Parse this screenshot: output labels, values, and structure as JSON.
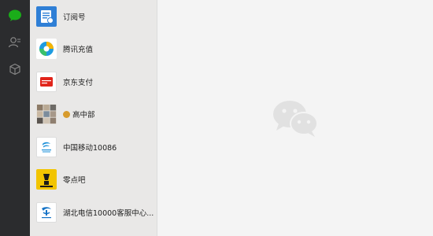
{
  "nav": {
    "items": [
      {
        "icon": "chat-bubble-icon",
        "active": true
      },
      {
        "icon": "contacts-icon",
        "active": false
      },
      {
        "icon": "cube-icon",
        "active": false
      }
    ]
  },
  "chat_list": {
    "items": [
      {
        "label": "订阅号",
        "avatar_icon": "subscription-icon",
        "avatar_color": "#2f7fd6"
      },
      {
        "label": "腾讯充值",
        "avatar_icon": "tencent-recharge-logo",
        "avatar_color": "#ffffff"
      },
      {
        "label": "京东支付",
        "avatar_icon": "jd-pay-logo",
        "avatar_color": "#e1251b"
      },
      {
        "label": "高中部",
        "avatar_icon": "group-avatar-icon",
        "avatar_color": "#c9c3b8"
      },
      {
        "label": "中国移动10086",
        "avatar_icon": "china-mobile-logo",
        "avatar_color": "#ffffff"
      },
      {
        "label": "零点吧",
        "avatar_icon": "lingdianba-logo",
        "avatar_color": "#f2c400"
      },
      {
        "label": "湖北电信10000客服中心...",
        "avatar_icon": "china-telecom-logo",
        "avatar_color": "#ffffff"
      }
    ]
  },
  "main": {
    "watermark_icon": "wechat-logo-icon"
  },
  "colors": {
    "rail_bg": "#2b2c2e",
    "list_bg": "#e9e8e7",
    "main_bg": "#f4f4f4",
    "accent_green": "#1aad19"
  }
}
